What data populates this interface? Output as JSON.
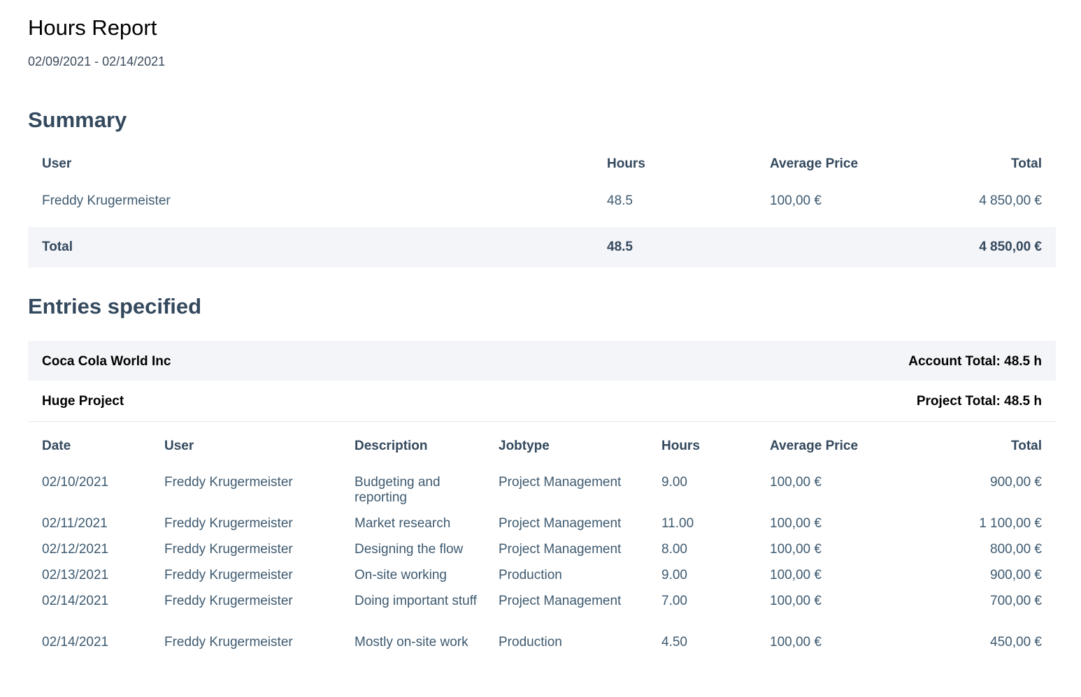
{
  "report": {
    "title": "Hours Report",
    "date_range": "02/09/2021 - 02/14/2021"
  },
  "summary": {
    "heading": "Summary",
    "columns": {
      "user": "User",
      "hours": "Hours",
      "average_price": "Average Price",
      "total": "Total"
    },
    "rows": [
      {
        "user": "Freddy Krugermeister",
        "hours": "48.5",
        "average_price": "100,00 €",
        "total": "4 850,00 €"
      }
    ],
    "total_row": {
      "label": "Total",
      "hours": "48.5",
      "total": "4 850,00 €"
    }
  },
  "entries": {
    "heading": "Entries specified",
    "account": {
      "name": "Coca Cola World Inc",
      "total": "Account Total: 48.5 h"
    },
    "project": {
      "name": "Huge Project",
      "total": "Project Total: 48.5 h"
    },
    "columns": {
      "date": "Date",
      "user": "User",
      "description": "Description",
      "jobtype": "Jobtype",
      "hours": "Hours",
      "average_price": "Average Price",
      "total": "Total"
    },
    "rows": [
      {
        "date": "02/10/2021",
        "user": "Freddy Krugermeister",
        "description": "Budgeting and reporting",
        "jobtype": "Project Management",
        "hours": "9.00",
        "average_price": "100,00 €",
        "total": "900,00 €"
      },
      {
        "date": "02/11/2021",
        "user": "Freddy Krugermeister",
        "description": "Market research",
        "jobtype": "Project Management",
        "hours": "11.00",
        "average_price": "100,00 €",
        "total": "1 100,00 €"
      },
      {
        "date": "02/12/2021",
        "user": "Freddy Krugermeister",
        "description": "Designing the flow",
        "jobtype": "Project Management",
        "hours": "8.00",
        "average_price": "100,00 €",
        "total": "800,00 €"
      },
      {
        "date": "02/13/2021",
        "user": "Freddy Krugermeister",
        "description": "On-site working",
        "jobtype": "Production",
        "hours": "9.00",
        "average_price": "100,00 €",
        "total": "900,00 €"
      },
      {
        "date": "02/14/2021",
        "user": "Freddy Krugermeister",
        "description": "Doing important stuff",
        "jobtype": "Project Management",
        "hours": "7.00",
        "average_price": "100,00 €",
        "total": "700,00 €"
      },
      {
        "date": "02/14/2021",
        "user": "Freddy Krugermeister",
        "description": "Mostly on-site work",
        "jobtype": "Production",
        "hours": "4.50",
        "average_price": "100,00 €",
        "total": "450,00 €"
      }
    ]
  },
  "colors": {
    "heading": "#34495e",
    "text": "#3e5a70",
    "band": "#f4f5f8"
  }
}
